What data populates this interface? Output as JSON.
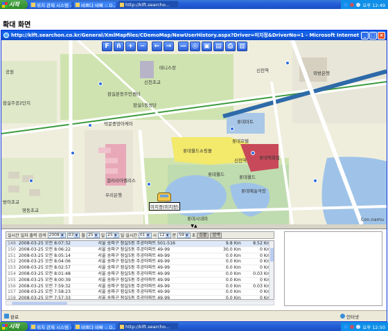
{
  "taskbar": {
    "start_label": "시작",
    "tasks": [
      "위치 관제 시스템 -...",
      "바쁘다 바빠 :: D...",
      "http://klft.searcho..."
    ],
    "clock_top": "오후 12:49",
    "clock_bottom": "오후 12:50"
  },
  "page": {
    "title": "확대 화면"
  },
  "window": {
    "title": "http://klft.searchon.co.kr/General/XmlMapfiles/CDemoMap/NewUserHistory.aspx?Driver=미지정&DriverNo=1 - Microsoft Internet Explorer",
    "minimize": "_",
    "maximize": "□",
    "close": "×"
  },
  "map": {
    "toolbar": [
      "F",
      "ñ",
      "+",
      "−",
      "←",
      "→",
      "—",
      "◎",
      "▣",
      "▤",
      "⎙",
      "▥"
    ],
    "places": {
      "tennis": "테니스장",
      "sinchon_school": "신천초교",
      "jamsil_elem": "잠실본동주민센터",
      "jamsil_church": "잠실5동성당",
      "bakmunkoreana": "박문중앙아케이",
      "jamsil_2": "잠실주공2단지",
      "gongwon": "공원",
      "lotte_mart": "롯데마트",
      "lotte_hotel": "롯데호텔",
      "lotte_world_mall": "롯데월드쇼핑몰",
      "sinchon_station": "신천역",
      "lotte_dept": "롯데백화점",
      "lotte_world": "롯데월드",
      "lotte_world_2": "롯데월드",
      "gallery": "갤러리아팰리스",
      "wooriyeon": "우리은행",
      "foreign": "롯데월드",
      "school_left": "방이초교",
      "yeonghwa": "영동초교",
      "lottecinema": "롯데시네마",
      "lotte_ice": "롯데예술극장",
      "right_station": "신천역",
      "oebang": "외방은행"
    },
    "car_label": "미지정(미지정)",
    "copyright": "Con.namu",
    "splitter": "▼▲"
  },
  "filter": {
    "label_a": "실시간",
    "label_b": "일자 출력 검색",
    "year": "2008",
    "month": "03",
    "month_unit": "월",
    "day": "25",
    "day_unit": "일",
    "day2": "25",
    "day2_unit": "일",
    "label_c": "실시간",
    "hour": "01",
    "hour_unit": "시",
    "min": "12",
    "min_unit": "분",
    "sec": "59",
    "sec_unit": "초",
    "label_d": "심볼",
    "search": "검색"
  },
  "rows": [
    {
      "no": "149",
      "time": "2008-03-25 오전 8:07:32",
      "addr": "서울 송파구 잠실5동 주공아파트 501-516",
      "speed": "9.8 Km",
      "dist": "8.52 Km"
    },
    {
      "no": "150",
      "time": "2008-03-25 오전 8:06:22",
      "addr": "서울 송파구 잠실5동 주공아파트 49-99",
      "speed": "30.0 Km",
      "dist": "0 Km"
    },
    {
      "no": "151",
      "time": "2008-03-25 오전 8:05:14",
      "addr": "서울 송파구 잠실5동 주공아파트 49-99",
      "speed": "0.0 Km",
      "dist": "0 Km"
    },
    {
      "no": "152",
      "time": "2008-03-25 오전 8:04:06",
      "addr": "서울 송파구 잠실5동 주공아파트 49-99",
      "speed": "0.0 Km",
      "dist": "0 Km"
    },
    {
      "no": "153",
      "time": "2008-03-25 오전 8:02:57",
      "addr": "서울 송파구 잠실5동 주공아파트 49-99",
      "speed": "0.0 Km",
      "dist": "0 Km"
    },
    {
      "no": "154",
      "time": "2008-03-25 오전 8:01:48",
      "addr": "서울 송파구 잠실5동 주공아파트 49-99",
      "speed": "0.0 Km",
      "dist": "0.03 Km"
    },
    {
      "no": "155",
      "time": "2008-03-25 오전 8:00:39",
      "addr": "서울 송파구 잠실5동 주공아파트 49-99",
      "speed": "0.0 Km",
      "dist": "0 Km"
    },
    {
      "no": "156",
      "time": "2008-03-25 오전 7:59:32",
      "addr": "서울 송파구 잠실5동 주공아파트 49-99",
      "speed": "0.0 Km",
      "dist": "0.03 Km"
    },
    {
      "no": "157",
      "time": "2008-03-25 오전 7:58:23",
      "addr": "서울 송파구 잠실5동 주공아파트 49-99",
      "speed": "0.0 Km",
      "dist": "0 Km"
    },
    {
      "no": "158",
      "time": "2008-03-25 오전 7:57:33",
      "addr": "서울 송파구 잠실5동 주공아파트 49-99",
      "speed": "0.0 Km",
      "dist": "0 Km"
    }
  ],
  "status": {
    "done": "완료",
    "zone": "인터넷"
  }
}
